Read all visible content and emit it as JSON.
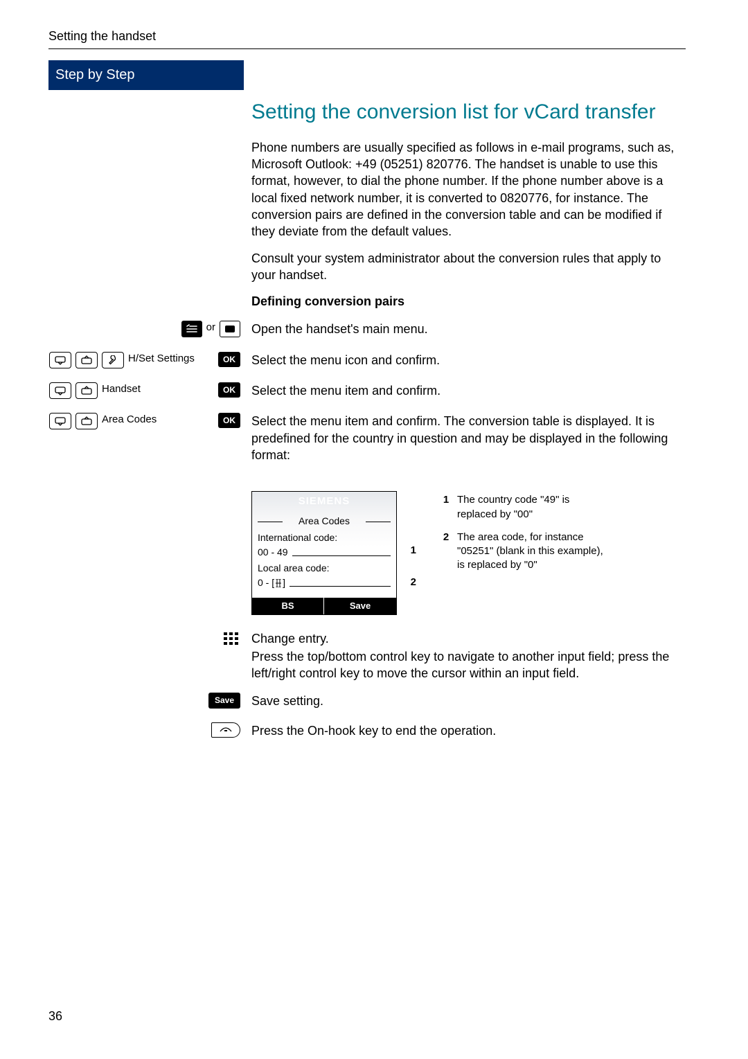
{
  "header": {
    "section": "Setting the handset"
  },
  "sidebar": {
    "heading": "Step by Step"
  },
  "title": "Setting the conversion list for vCard transfer",
  "paragraphs": {
    "p1": "Phone numbers are usually specified as follows in e-mail programs, such as, Microsoft Outlook: +49 (05251) 820776. The handset is unable to use this format, however, to dial the phone number. If the phone number above is a local fixed network number, it is converted to 0820776, for instance. The conversion pairs are defined in the conversion table and can be modified if they deviate from the default values.",
    "p2": "Consult your system administrator about the conversion rules that apply to your handset.",
    "subheading": "Defining conversion pairs"
  },
  "steps": {
    "or": "or",
    "open_menu": "Open the handset's main menu.",
    "hset_label": "H/Set Settings",
    "select_icon": "Select the menu icon and confirm.",
    "handset_label": "Handset",
    "select_item1": "Select the menu item and confirm.",
    "areacodes_label": "Area Codes",
    "select_item2": "Select the menu item and confirm. The conversion table is displayed. It is predefined for the country in question and may be displayed in the following format:",
    "change_entry": "Change entry.",
    "navigate": "Press the top/bottom control key to navigate to another input field; press the left/right control key to move the cursor within an input field.",
    "save_label": "Save",
    "save_setting": "Save setting.",
    "onhook": "Press the On-hook key to end the operation."
  },
  "screen": {
    "brand": "SIEMENS",
    "title": "Area Codes",
    "intl_label": "International code:",
    "intl_val": "00   -  49",
    "local_label": "Local area code:",
    "local_val": "0     -   [‎‎ ",
    "local_val_end": "      ]",
    "soft_left": "BS",
    "soft_right": "Save",
    "callout_1": "1",
    "callout_2": "2"
  },
  "legend": {
    "n1": "1",
    "t1": "The country code \"49\" is replaced by \"00\"",
    "n2": "2",
    "t2": "The area code, for instance \"05251\" (blank in this example), is replaced by \"0\""
  },
  "page_number": "36"
}
